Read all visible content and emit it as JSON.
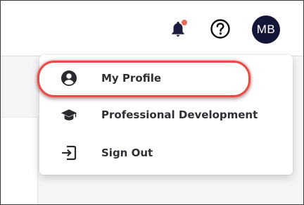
{
  "header": {
    "notifications_icon": "bell-icon",
    "notification_dot_color": "#e8685c",
    "help_icon": "help-circle-icon",
    "avatar": {
      "initials": "MB",
      "background": "#141638"
    }
  },
  "user_menu": {
    "items": [
      {
        "label": "My Profile",
        "icon": "user-circle-icon",
        "highlighted": true
      },
      {
        "label": "Professional Development",
        "icon": "graduation-cap-icon"
      },
      {
        "label": "Sign Out",
        "icon": "sign-out-icon"
      }
    ],
    "highlight_color": "#e74c46"
  }
}
